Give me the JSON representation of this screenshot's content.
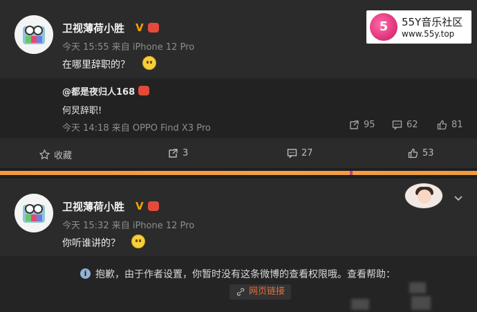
{
  "watermark": {
    "logo_text": "5",
    "title": "55Y音乐社区",
    "url": "www.55y.top"
  },
  "post1": {
    "username": "卫视薄荷小胜",
    "meta": "今天 15:55 来自 iPhone 12 Pro",
    "content": "在哪里辞职的？",
    "repost": {
      "author": "@都是夜归人168",
      "text": "何炅辞职!",
      "meta": "今天 14:18 来自 OPPO Find X3 Pro",
      "reposts": "95",
      "comments": "62",
      "likes": "81"
    },
    "actions": {
      "favorite_label": "收藏",
      "repost_count": "3",
      "comment_count": "27",
      "like_count": "53"
    }
  },
  "post2": {
    "username": "卫视薄荷小胜",
    "meta": "今天 15:32 来自 iPhone 12 Pro",
    "content": "你听谁讲的？",
    "notice": "抱歉，由于作者设置，你暂时没有这条微博的查看权限哦。查看帮助：",
    "link_label": "网页链接"
  },
  "icons": [
    "star-icon",
    "repost-icon",
    "comment-icon",
    "like-icon",
    "info-icon",
    "link-icon",
    "chevron-down-icon"
  ]
}
